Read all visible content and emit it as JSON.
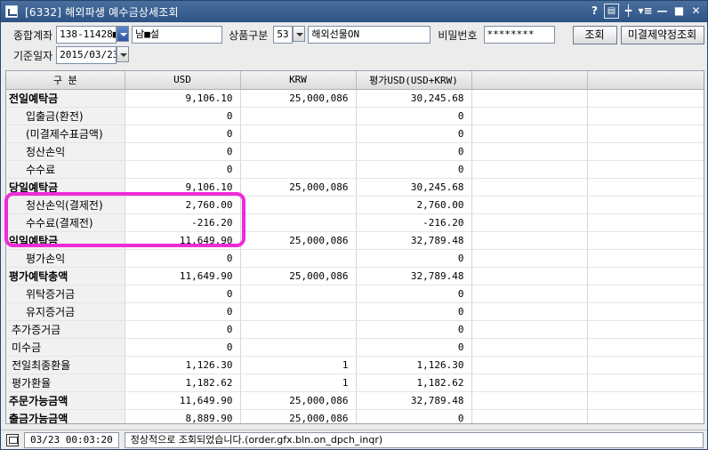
{
  "window": {
    "title": "[6332] 해외파생 예수금상세조회",
    "buttons": [
      "?",
      "▤",
      "┿",
      "▾≡",
      "—",
      "■",
      "✕"
    ]
  },
  "toolbar": {
    "account_label": "종합계좌",
    "account_no": "138-11428■",
    "account_name": "남■설",
    "product_label": "상품구분",
    "product_code": "53",
    "product_name": "해외선물ON",
    "password_label": "비밀번호",
    "password_value": "********",
    "search_button": "조회",
    "unsettled_button": "미결제약정조회",
    "date_label": "기준일자",
    "date_value": "2015/03/23"
  },
  "table": {
    "headers": [
      "구  분",
      "USD",
      "KRW",
      "평가USD(USD+KRW)"
    ],
    "rows": [
      {
        "name": "전일예탁금",
        "usd": "9,106.10",
        "krw": "25,000,086",
        "eval": "30,245.68"
      },
      {
        "name": "입출금(환전)",
        "usd": "0",
        "krw": "",
        "eval": "0"
      },
      {
        "name": "(미결제수표금액)",
        "usd": "0",
        "krw": "",
        "eval": "0"
      },
      {
        "name": "청산손익",
        "usd": "0",
        "krw": "",
        "eval": "0"
      },
      {
        "name": "수수료",
        "usd": "0",
        "krw": "",
        "eval": "0"
      },
      {
        "name": "당일예탁금",
        "usd": "9,106.10",
        "krw": "25,000,086",
        "eval": "30,245.68"
      },
      {
        "name": "청산손익(결제전)",
        "usd": "2,760.00",
        "krw": "",
        "eval": "2,760.00"
      },
      {
        "name": "수수료(결제전)",
        "usd": "-216.20",
        "krw": "",
        "eval": "-216.20"
      },
      {
        "name": "익일예탁금",
        "usd": "11,649.90",
        "krw": "25,000,086",
        "eval": "32,789.48"
      },
      {
        "name": "평가손익",
        "usd": "0",
        "krw": "",
        "eval": "0"
      },
      {
        "name": "평가예탁총액",
        "usd": "11,649.90",
        "krw": "25,000,086",
        "eval": "32,789.48"
      },
      {
        "name": "위탁증거금",
        "usd": "0",
        "krw": "",
        "eval": "0"
      },
      {
        "name": "유지증거금",
        "usd": "0",
        "krw": "",
        "eval": "0"
      },
      {
        "name": "추가증거금",
        "usd": "0",
        "krw": "",
        "eval": "0"
      },
      {
        "name": "미수금",
        "usd": "0",
        "krw": "",
        "eval": "0"
      },
      {
        "name": "전일최종환율",
        "usd": "1,126.30",
        "krw": "1",
        "eval": "1,126.30"
      },
      {
        "name": "평가환율",
        "usd": "1,182.62",
        "krw": "1",
        "eval": "1,182.62"
      },
      {
        "name": "주문가능금액",
        "usd": "11,649.90",
        "krw": "25,000,086",
        "eval": "32,789.48"
      },
      {
        "name": "출금가능금액",
        "usd": "8,889.90",
        "krw": "25,000,086",
        "eval": "0"
      }
    ]
  },
  "status": {
    "time": "03/23 00:03:20",
    "message": "정상적으로 조회되었습니다.(order.gfx.bln.on_dpch_inqr)"
  },
  "colors": {
    "titlebar": "#2d5385",
    "highlight": "#ef2bd8"
  }
}
